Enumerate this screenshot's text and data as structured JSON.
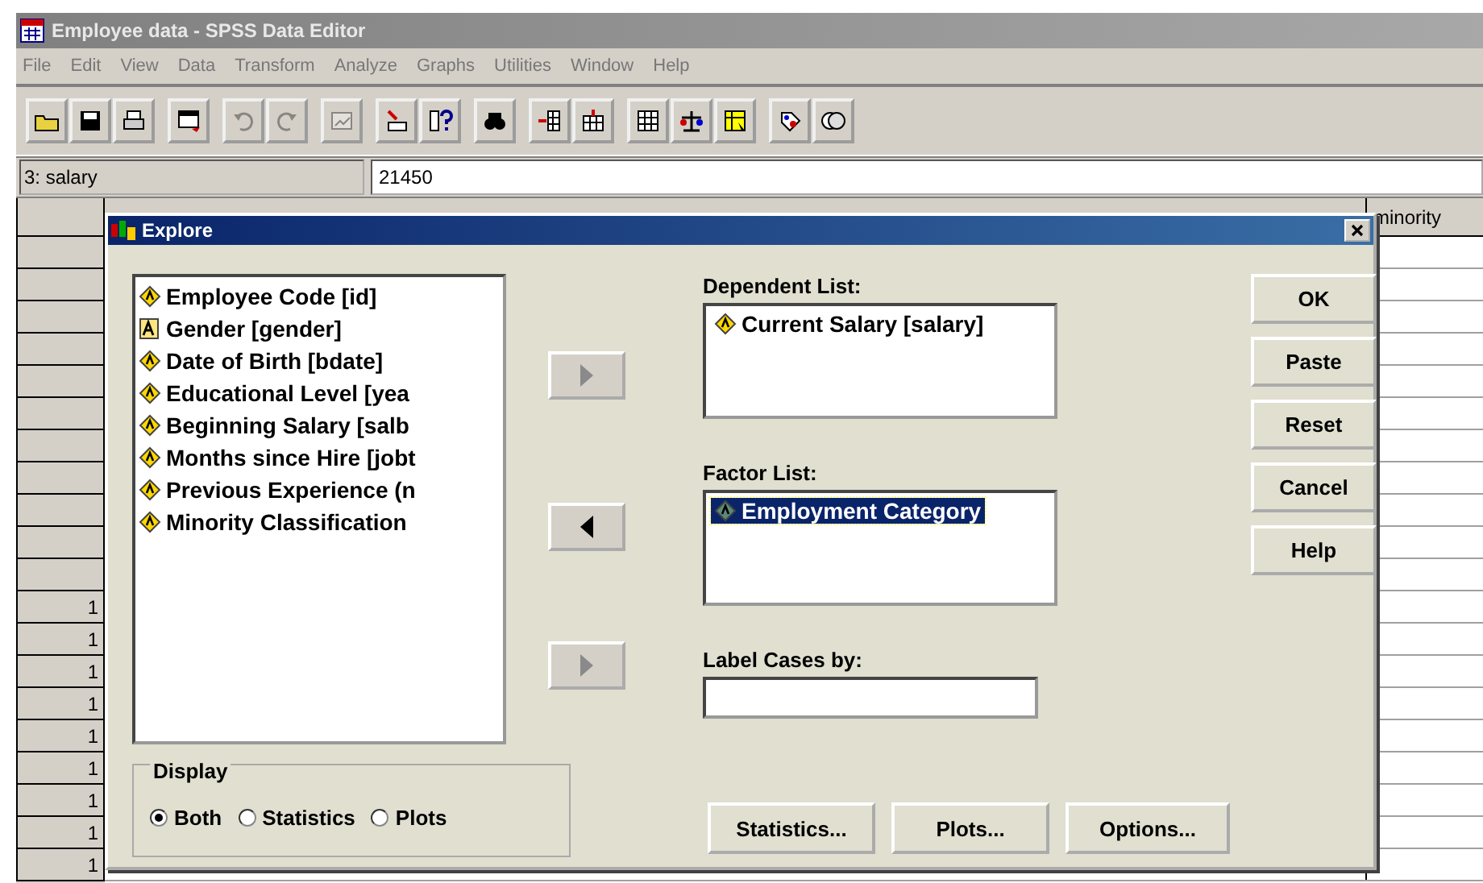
{
  "window": {
    "title": "Employee data - SPSS Data Editor"
  },
  "menu": [
    "File",
    "Edit",
    "View",
    "Data",
    "Transform",
    "Analyze",
    "Graphs",
    "Utilities",
    "Window",
    "Help"
  ],
  "toolbar": {
    "groups": [
      [
        {
          "disabled": false
        },
        {
          "disabled": false
        },
        {
          "disabled": false
        }
      ],
      [
        {
          "disabled": false
        }
      ],
      [
        {
          "disabled": true
        },
        {
          "disabled": true
        }
      ],
      [
        {
          "disabled": true
        }
      ],
      [
        {
          "disabled": false
        },
        {
          "disabled": false
        }
      ],
      [
        {
          "disabled": false
        }
      ],
      [
        {
          "disabled": false
        },
        {
          "disabled": false
        }
      ],
      [
        {
          "disabled": false
        },
        {
          "disabled": false
        },
        {
          "disabled": false
        }
      ],
      [
        {
          "disabled": false
        },
        {
          "disabled": false
        }
      ]
    ]
  },
  "cell_bar": {
    "cell": "3: salary",
    "value": "21450"
  },
  "grid": {
    "column_header": "minority",
    "row_labels": [
      "1",
      "1",
      "1",
      "1",
      "1",
      "1",
      "1",
      "1",
      "1"
    ]
  },
  "dialog": {
    "title": "Explore",
    "variables": [
      {
        "label": "Employee Code [id]",
        "kind": "numeric"
      },
      {
        "label": "Gender [gender]",
        "kind": "string"
      },
      {
        "label": "Date of Birth [bdate]",
        "kind": "numeric"
      },
      {
        "label": "Educational Level [yea",
        "kind": "numeric"
      },
      {
        "label": "Beginning Salary [salb",
        "kind": "numeric"
      },
      {
        "label": "Months since Hire [jobt",
        "kind": "numeric"
      },
      {
        "label": "Previous Experience (n",
        "kind": "numeric"
      },
      {
        "label": "Minority Classification",
        "kind": "numeric"
      }
    ],
    "move_buttons": [
      {
        "kind": "right",
        "disabled": true
      },
      {
        "kind": "left",
        "disabled": false
      },
      {
        "kind": "right",
        "disabled": true
      }
    ],
    "dependent_list": {
      "label": "Dependent List:",
      "items": [
        {
          "label": "Current Salary [salary]",
          "kind": "numeric",
          "selected": false
        }
      ]
    },
    "factor_list": {
      "label": "Factor List:",
      "items": [
        {
          "label": "Employment Category",
          "kind": "numeric",
          "selected": true
        }
      ]
    },
    "label_cases": {
      "label": "Label Cases by:"
    },
    "buttons": [
      "OK",
      "Paste",
      "Reset",
      "Cancel",
      "Help"
    ],
    "display": {
      "title": "Display",
      "options": [
        {
          "label": "Both",
          "selected": true
        },
        {
          "label": "Statistics",
          "selected": false
        },
        {
          "label": "Plots",
          "selected": false
        }
      ]
    },
    "bottom_buttons": [
      "Statistics...",
      "Plots...",
      "Options..."
    ]
  }
}
